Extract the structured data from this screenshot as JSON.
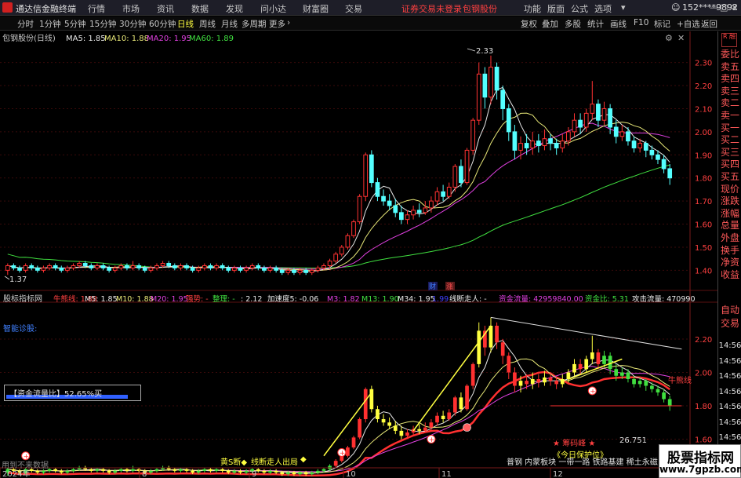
{
  "titlebar": {
    "app_name": "通达信金融终端",
    "menu": [
      "行情",
      "市场",
      "资讯",
      "数据",
      "发现",
      "问小达",
      "财富圈",
      "交易"
    ],
    "notice": "证券交易未登录",
    "stock": "包钢股份",
    "right_menu": [
      "功能",
      "版面",
      "公式",
      "选项"
    ],
    "user": "152****9892",
    "back": "返回",
    "window_controls": [
      "minimize-icon",
      "maximize-icon",
      "close-icon"
    ]
  },
  "toolbar": {
    "periods": [
      "分时",
      "1分钟",
      "5分钟",
      "15分钟",
      "30分钟",
      "60分钟",
      "日线",
      "周线",
      "月线",
      "多周期",
      "更多"
    ],
    "active_period": "日线",
    "right_tools": [
      "复权",
      "叠加",
      "多股",
      "统计",
      "画线",
      "F10",
      "标记",
      "+自选",
      "返回"
    ]
  },
  "main_chart": {
    "title": "包钢股份(日线)",
    "ma": [
      {
        "label": "MA5: 1.85",
        "color": "#e8e8e8"
      },
      {
        "label": "MA10: 1.88",
        "color": "#e8e878"
      },
      {
        "label": "MA20: 1.95",
        "color": "#e040e0"
      },
      {
        "label": "MA60: 1.89",
        "color": "#40e040"
      }
    ],
    "high_marker": "2.33",
    "low_marker": "1.37",
    "markers": [
      "财",
      "涨"
    ]
  },
  "sub_chart": {
    "title": "股标指标网",
    "items": [
      {
        "label": "牛熊线: 1.88",
        "color": "#ff4040"
      },
      {
        "label": "M5: 1.85",
        "color": "#e8e8e8"
      },
      {
        "label": "M10: 1.88",
        "color": "#e8e878"
      },
      {
        "label": "M20: 1.95",
        "color": "#e040e0"
      },
      {
        "label": "强势: -",
        "color": "#ff4040"
      },
      {
        "label": "整理: -",
        "color": "#40e040"
      },
      {
        "label": ": 2.12",
        "color": "#e8e8e8"
      },
      {
        "label": "加速度5: -0.06",
        "color": "#e8e8e8"
      },
      {
        "label": "M3: 1.82",
        "color": "#e040e0"
      },
      {
        "label": "M13: 1.90",
        "color": "#40e040"
      },
      {
        "label": "M34: 1.95",
        "color": "#e8e8e8"
      },
      {
        "label": "1.99",
        "color": "#4040ff"
      },
      {
        "label": "线断走人: -",
        "color": "#e8e8e8"
      },
      {
        "label": "资金流量: 42959840.00",
        "color": "#e040e0"
      },
      {
        "label": "资金比: 5.31",
        "color": "#40e040"
      },
      {
        "label": "攻击流量: 470990",
        "color": "#e8e8e8"
      }
    ],
    "diagnosis": "智能诊股:",
    "fund_box": "【资金流量比】52.65%买",
    "fund_ratio": 0.5265,
    "bull_bear_tag": "牛熊线",
    "chip_label": "★ 筹码峰 ★",
    "chip_value": "26.751",
    "bottom_text": [
      "黄S断◆",
      "线断走人出局",
      "◆"
    ],
    "concept_text": "普钢 内蒙板块 一带一路 铁路基建 稀土永磁",
    "bottom_left_text": "用到不来数据",
    "dashed_text": "《今日保护位》"
  },
  "x_axis": {
    "labels": [
      "2024年",
      "8",
      "9",
      "10",
      "11",
      "12"
    ]
  },
  "right_axis_main": {
    "ticks": [
      "2.30",
      "2.20",
      "2.10",
      "2.00",
      "1.90",
      "1.80",
      "1.70",
      "1.60",
      "1.50",
      "1.40"
    ]
  },
  "right_axis_sub": {
    "ticks": [
      "2.20",
      "2.00",
      "1.80",
      "1.60"
    ]
  },
  "right_axis_time": [
    "14:56",
    "14:56",
    "14:56",
    "14:56",
    "14:56",
    "14:56",
    "14:56",
    "14:56",
    "14:56"
  ],
  "right_panel": {
    "badge": "R\n融",
    "items": [
      "委比",
      "卖五",
      "卖四",
      "卖三",
      "卖二",
      "卖一",
      "买一",
      "买二",
      "买三",
      "买四",
      "买五",
      "现价",
      "涨跌",
      "涨幅",
      "总量",
      "外盘",
      "换手",
      "净资",
      "收益",
      "自动",
      "交易"
    ]
  },
  "watermark": {
    "line1": "股票指标网",
    "line2": "www.7gpzb.com"
  },
  "chart_data": {
    "type": "candlestick",
    "title": "包钢股份(日线)",
    "ylim": [
      1.34,
      2.36
    ],
    "sub_ylim": [
      1.48,
      2.36
    ],
    "colors": {
      "up": "#ff3232",
      "down": "#54ffff",
      "ma5": "#e8e8e8",
      "ma10": "#e8e878",
      "ma20": "#e040e0",
      "ma60": "#40e040"
    },
    "candles": [
      [
        1.4,
        1.42,
        1.43,
        1.38
      ],
      [
        1.42,
        1.41,
        1.43,
        1.4
      ],
      [
        1.41,
        1.4,
        1.42,
        1.39
      ],
      [
        1.4,
        1.42,
        1.43,
        1.39
      ],
      [
        1.42,
        1.41,
        1.43,
        1.4
      ],
      [
        1.41,
        1.4,
        1.42,
        1.39
      ],
      [
        1.4,
        1.41,
        1.42,
        1.39
      ],
      [
        1.41,
        1.42,
        1.43,
        1.4
      ],
      [
        1.42,
        1.41,
        1.43,
        1.4
      ],
      [
        1.41,
        1.4,
        1.42,
        1.39
      ],
      [
        1.4,
        1.41,
        1.42,
        1.39
      ],
      [
        1.41,
        1.42,
        1.43,
        1.4
      ],
      [
        1.42,
        1.43,
        1.44,
        1.41
      ],
      [
        1.43,
        1.42,
        1.44,
        1.41
      ],
      [
        1.42,
        1.41,
        1.43,
        1.4
      ],
      [
        1.41,
        1.42,
        1.43,
        1.4
      ],
      [
        1.42,
        1.41,
        1.43,
        1.4
      ],
      [
        1.41,
        1.4,
        1.42,
        1.39
      ],
      [
        1.4,
        1.41,
        1.42,
        1.39
      ],
      [
        1.41,
        1.42,
        1.43,
        1.4
      ],
      [
        1.42,
        1.41,
        1.43,
        1.4
      ],
      [
        1.41,
        1.42,
        1.44,
        1.4
      ],
      [
        1.42,
        1.41,
        1.43,
        1.4
      ],
      [
        1.41,
        1.4,
        1.42,
        1.39
      ],
      [
        1.4,
        1.41,
        1.42,
        1.39
      ],
      [
        1.41,
        1.42,
        1.43,
        1.4
      ],
      [
        1.42,
        1.43,
        1.44,
        1.41
      ],
      [
        1.43,
        1.42,
        1.44,
        1.41
      ],
      [
        1.42,
        1.41,
        1.43,
        1.4
      ],
      [
        1.41,
        1.42,
        1.43,
        1.4
      ],
      [
        1.42,
        1.41,
        1.43,
        1.4
      ],
      [
        1.41,
        1.4,
        1.42,
        1.39
      ],
      [
        1.4,
        1.41,
        1.42,
        1.39
      ],
      [
        1.41,
        1.42,
        1.43,
        1.4
      ],
      [
        1.42,
        1.41,
        1.43,
        1.4
      ],
      [
        1.41,
        1.42,
        1.43,
        1.4
      ],
      [
        1.42,
        1.41,
        1.43,
        1.4
      ],
      [
        1.41,
        1.4,
        1.42,
        1.39
      ],
      [
        1.4,
        1.41,
        1.42,
        1.39
      ],
      [
        1.41,
        1.4,
        1.42,
        1.39
      ],
      [
        1.4,
        1.41,
        1.42,
        1.39
      ],
      [
        1.41,
        1.42,
        1.43,
        1.4
      ],
      [
        1.42,
        1.41,
        1.43,
        1.4
      ],
      [
        1.41,
        1.4,
        1.42,
        1.39
      ],
      [
        1.4,
        1.41,
        1.42,
        1.39
      ],
      [
        1.41,
        1.4,
        1.42,
        1.39
      ],
      [
        1.4,
        1.39,
        1.41,
        1.38
      ],
      [
        1.39,
        1.4,
        1.41,
        1.38
      ],
      [
        1.4,
        1.39,
        1.41,
        1.38
      ],
      [
        1.39,
        1.4,
        1.41,
        1.38
      ],
      [
        1.4,
        1.39,
        1.41,
        1.38
      ],
      [
        1.39,
        1.4,
        1.41,
        1.38
      ],
      [
        1.4,
        1.41,
        1.42,
        1.39
      ],
      [
        1.41,
        1.42,
        1.43,
        1.4
      ],
      [
        1.42,
        1.44,
        1.45,
        1.41
      ],
      [
        1.44,
        1.47,
        1.48,
        1.43
      ],
      [
        1.47,
        1.5,
        1.51,
        1.46
      ],
      [
        1.5,
        1.55,
        1.56,
        1.49
      ],
      [
        1.55,
        1.61,
        1.62,
        1.54
      ],
      [
        1.61,
        1.72,
        1.73,
        1.6
      ],
      [
        1.72,
        1.9,
        1.91,
        1.7
      ],
      [
        1.9,
        1.78,
        1.92,
        1.76
      ],
      [
        1.78,
        1.72,
        1.8,
        1.7
      ],
      [
        1.72,
        1.7,
        1.75,
        1.68
      ],
      [
        1.7,
        1.68,
        1.73,
        1.66
      ],
      [
        1.68,
        1.65,
        1.71,
        1.63
      ],
      [
        1.65,
        1.62,
        1.68,
        1.6
      ],
      [
        1.62,
        1.64,
        1.66,
        1.6
      ],
      [
        1.64,
        1.66,
        1.68,
        1.62
      ],
      [
        1.66,
        1.65,
        1.69,
        1.63
      ],
      [
        1.65,
        1.67,
        1.7,
        1.64
      ],
      [
        1.67,
        1.7,
        1.72,
        1.65
      ],
      [
        1.7,
        1.74,
        1.76,
        1.68
      ],
      [
        1.74,
        1.72,
        1.77,
        1.7
      ],
      [
        1.72,
        1.76,
        1.78,
        1.71
      ],
      [
        1.76,
        1.85,
        1.86,
        1.74
      ],
      [
        1.85,
        1.78,
        1.88,
        1.76
      ],
      [
        1.78,
        1.92,
        1.93,
        1.77
      ],
      [
        1.92,
        2.05,
        2.06,
        1.9
      ],
      [
        2.05,
        2.25,
        2.3,
        2.03
      ],
      [
        2.25,
        2.15,
        2.28,
        2.1
      ],
      [
        2.15,
        2.28,
        2.33,
        2.12
      ],
      [
        2.28,
        2.18,
        2.3,
        2.14
      ],
      [
        2.18,
        2.1,
        2.2,
        2.05
      ],
      [
        2.1,
        2.0,
        2.12,
        1.96
      ],
      [
        2.0,
        1.92,
        2.03,
        1.88
      ],
      [
        1.92,
        1.95,
        1.98,
        1.88
      ],
      [
        1.95,
        1.93,
        1.99,
        1.9
      ],
      [
        1.93,
        1.96,
        2.0,
        1.9
      ],
      [
        1.96,
        1.94,
        1.99,
        1.91
      ],
      [
        1.94,
        1.97,
        2.01,
        1.92
      ],
      [
        1.97,
        1.95,
        1.99,
        1.92
      ],
      [
        1.95,
        1.93,
        1.97,
        1.9
      ],
      [
        1.93,
        1.96,
        1.99,
        1.91
      ],
      [
        1.96,
        2.0,
        2.02,
        1.94
      ],
      [
        2.0,
        2.05,
        2.08,
        1.98
      ],
      [
        2.05,
        2.02,
        2.08,
        1.99
      ],
      [
        2.02,
        2.08,
        2.1,
        2.0
      ],
      [
        2.08,
        2.12,
        2.22,
        2.05
      ],
      [
        2.12,
        2.05,
        2.14,
        2.02
      ],
      [
        2.05,
        2.1,
        2.13,
        2.03
      ],
      [
        2.1,
        2.02,
        2.12,
        1.99
      ],
      [
        2.02,
        1.98,
        2.05,
        1.95
      ],
      [
        1.98,
        2.0,
        2.03,
        1.96
      ],
      [
        2.0,
        1.96,
        2.02,
        1.94
      ],
      [
        1.96,
        1.93,
        1.98,
        1.91
      ],
      [
        1.93,
        1.95,
        1.97,
        1.91
      ],
      [
        1.95,
        1.92,
        1.96,
        1.89
      ],
      [
        1.92,
        1.9,
        1.94,
        1.88
      ],
      [
        1.9,
        1.88,
        1.92,
        1.86
      ],
      [
        1.88,
        1.84,
        1.9,
        1.82
      ],
      [
        1.84,
        1.8,
        1.86,
        1.77
      ]
    ]
  }
}
